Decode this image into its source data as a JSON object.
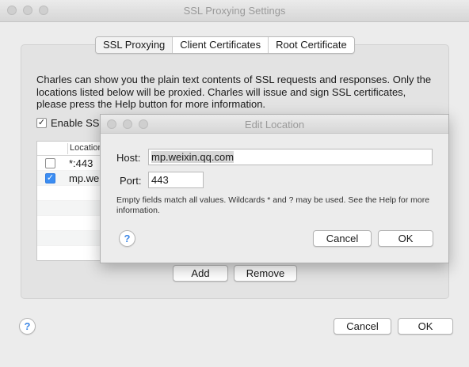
{
  "window": {
    "title": "SSL Proxying Settings"
  },
  "tabs": [
    {
      "label": "SSL Proxying",
      "selected": true
    },
    {
      "label": "Client Certificates",
      "selected": false
    },
    {
      "label": "Root Certificate",
      "selected": false
    }
  ],
  "description": "Charles can show you the plain text contents of SSL requests and responses. Only the locations listed below will be proxied. Charles will issue and sign SSL certificates, please press the Help button for more information.",
  "enable_checkbox": {
    "label": "Enable SS",
    "checked": true
  },
  "locations_table": {
    "column": "Location",
    "rows": [
      {
        "checked": false,
        "text": "*:443"
      },
      {
        "checked": true,
        "text": "mp.wei"
      }
    ]
  },
  "buttons": {
    "add": "Add",
    "remove": "Remove",
    "cancel": "Cancel",
    "ok": "OK",
    "help": "?"
  },
  "dialog": {
    "title": "Edit Location",
    "host_label": "Host:",
    "host_value": "mp.weixin.qq.com",
    "port_label": "Port:",
    "port_value": "443",
    "note": "Empty fields match all values. Wildcards * and ? may be used. See the Help for more information.",
    "help": "?",
    "cancel": "Cancel",
    "ok": "OK"
  },
  "colors": {
    "accent": "#3b8df2",
    "help_icon": "#3f88e6"
  }
}
